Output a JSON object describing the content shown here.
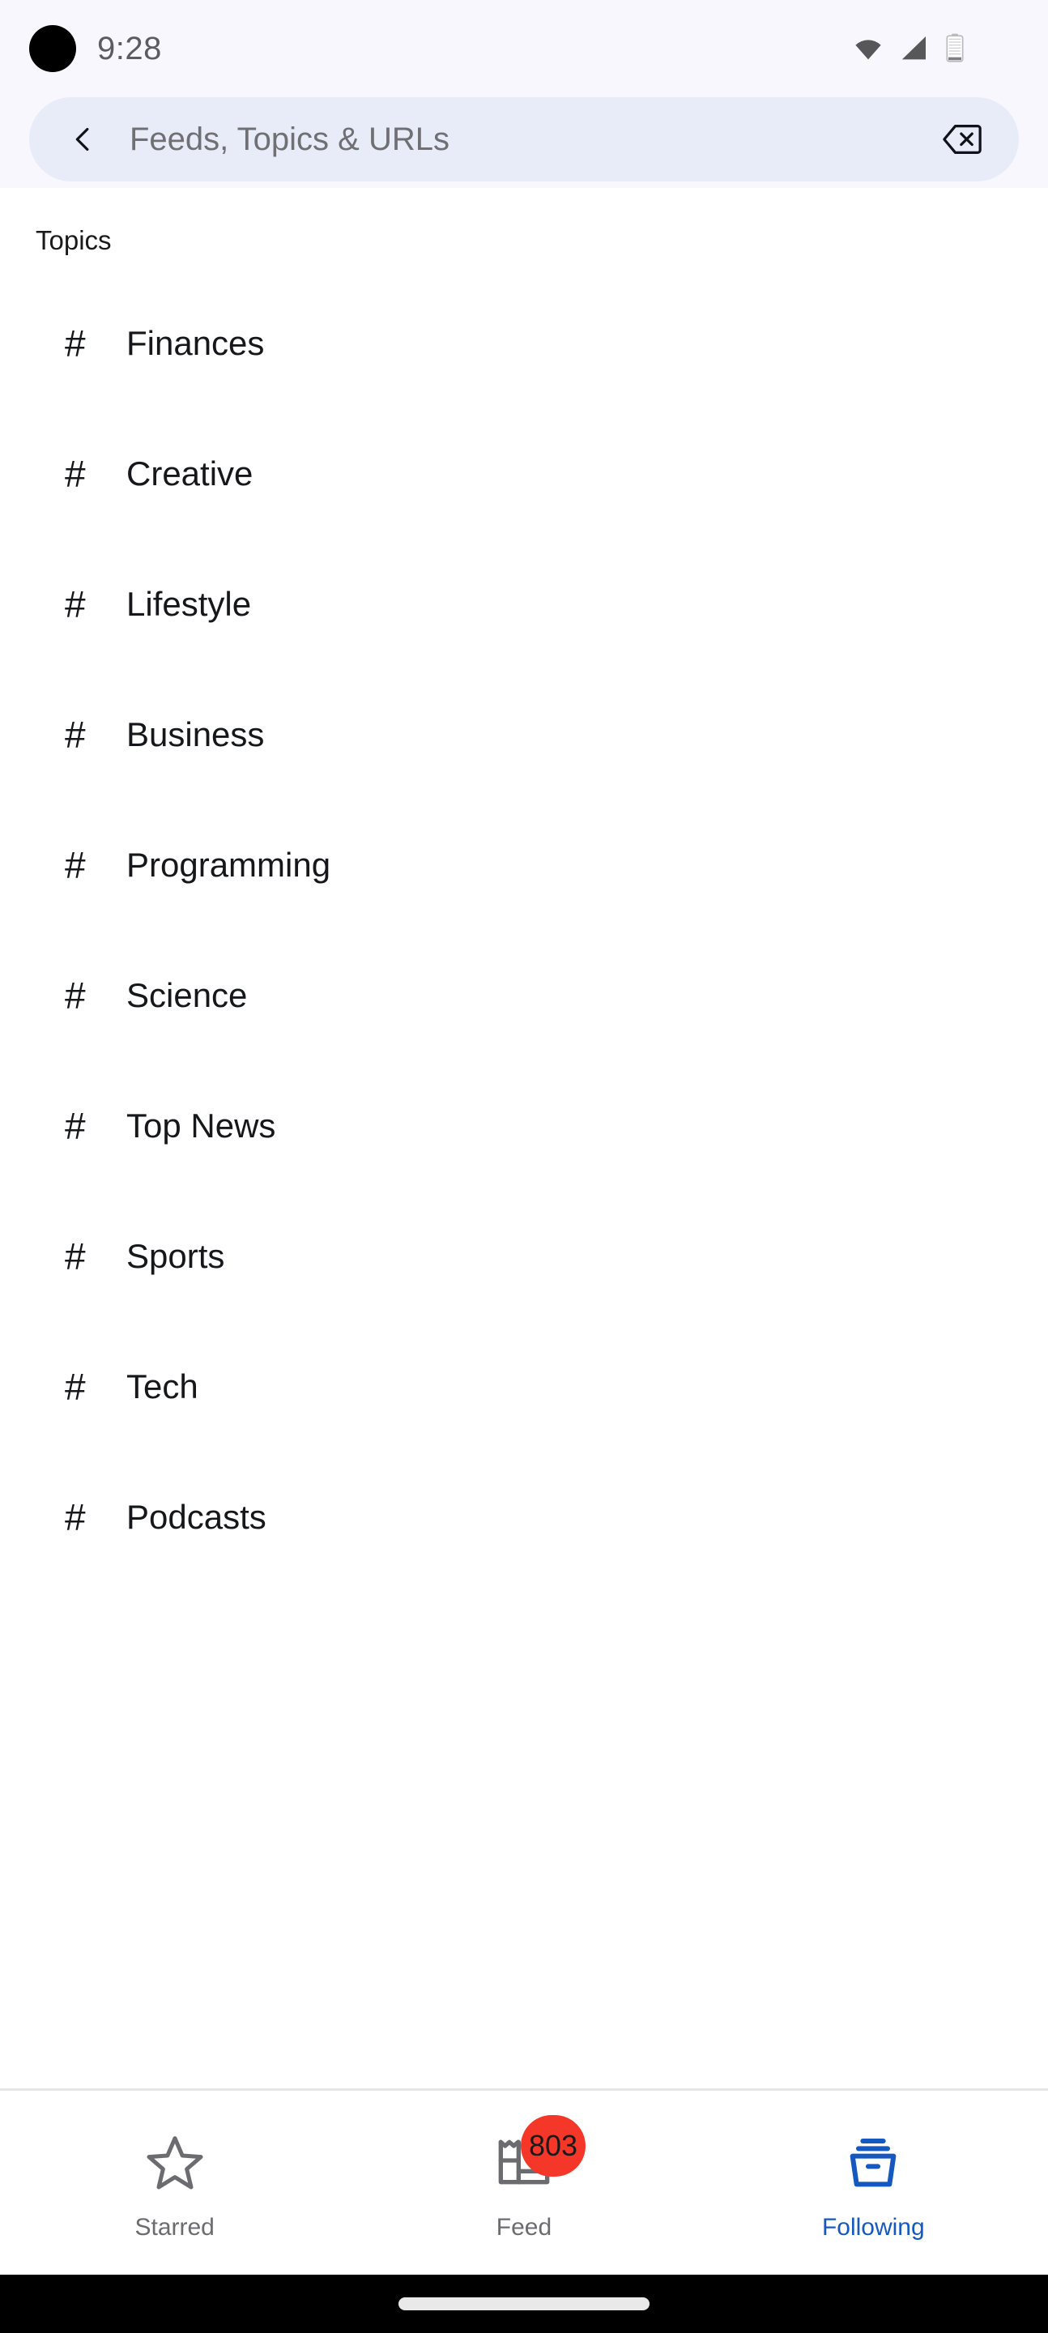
{
  "status_bar": {
    "time": "9:28",
    "icons": [
      "camera-dot",
      "wifi-icon",
      "signal-icon",
      "battery-icon"
    ]
  },
  "search": {
    "placeholder": "Feeds, Topics & URLs",
    "value": "",
    "back_icon": "chevron-left-icon",
    "clear_icon": "backspace-icon"
  },
  "main": {
    "section_title": "Topics",
    "topic_prefix": "#",
    "topics": [
      {
        "label": "Finances"
      },
      {
        "label": "Creative"
      },
      {
        "label": "Lifestyle"
      },
      {
        "label": "Business"
      },
      {
        "label": "Programming"
      },
      {
        "label": "Science"
      },
      {
        "label": "Top News"
      },
      {
        "label": "Sports"
      },
      {
        "label": "Tech"
      },
      {
        "label": "Podcasts"
      }
    ]
  },
  "bottom_nav": {
    "items": [
      {
        "label": "Starred",
        "icon": "star-icon",
        "active": false,
        "badge": ""
      },
      {
        "label": "Feed",
        "icon": "newspaper-icon",
        "active": false,
        "badge": "803"
      },
      {
        "label": "Following",
        "icon": "archive-inbox-icon",
        "active": true,
        "badge": ""
      }
    ]
  },
  "colors": {
    "accent": "#1559c0",
    "badge": "#f5372a",
    "searchbar_bg": "#e7ecf8",
    "top_region_bg": "#f7f7fd",
    "inactive_text": "#6c6c70"
  }
}
